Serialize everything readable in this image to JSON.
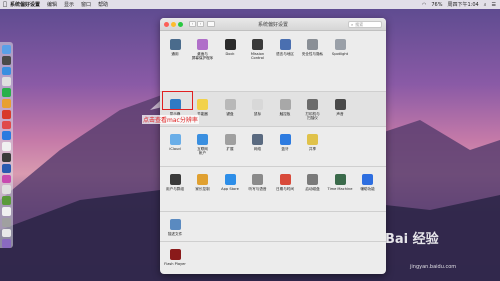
{
  "menubar": {
    "apple": "",
    "items": [
      "系统偏好设置",
      "编辑",
      "显示",
      "窗口",
      "帮助"
    ],
    "right": {
      "battery": "76%",
      "clock": "周四下午1:04"
    }
  },
  "window": {
    "title": "系统偏好设置",
    "search_placeholder": "搜索",
    "traffic_lights": [
      "#fc5f57",
      "#fdbc2e",
      "#28c840"
    ],
    "sections": [
      {
        "panes": [
          {
            "label": "通用",
            "icon": "general-icon",
            "color": "#4a6b8c"
          },
          {
            "label": "桌面与\n屏幕保护程序",
            "icon": "desktop-icon",
            "color": "#b06fc9"
          },
          {
            "label": "Dock",
            "icon": "dock-icon",
            "color": "#2b2b2b"
          },
          {
            "label": "Mission\nControl",
            "icon": "mission-control-icon",
            "color": "#3a3a3a"
          },
          {
            "label": "语言与地区",
            "icon": "language-icon",
            "color": "#4a6fb0"
          },
          {
            "label": "安全性与隐私",
            "icon": "security-icon",
            "color": "#8a8f96"
          },
          {
            "label": "Spotlight",
            "icon": "spotlight-icon",
            "color": "#9aa0a8"
          }
        ]
      },
      {
        "panes": [
          {
            "label": "显示器",
            "icon": "display-icon",
            "color": "#2f7bc4"
          },
          {
            "label": "节能器",
            "icon": "energy-saver-icon",
            "color": "#f2d24a"
          },
          {
            "label": "键盘",
            "icon": "keyboard-icon",
            "color": "#b8b8b8"
          },
          {
            "label": "鼠标",
            "icon": "mouse-icon",
            "color": "#d8d8d8"
          },
          {
            "label": "触控板",
            "icon": "trackpad-icon",
            "color": "#a8a8a8"
          },
          {
            "label": "打印机与\n扫描仪",
            "icon": "printer-icon",
            "color": "#6b6b6b"
          },
          {
            "label": "声音",
            "icon": "sound-icon",
            "color": "#4a4a4a"
          }
        ]
      },
      {
        "panes": [
          {
            "label": "iCloud",
            "icon": "icloud-icon",
            "color": "#6aaee8"
          },
          {
            "label": "互联网\n帐户",
            "icon": "internet-accounts-icon",
            "color": "#3a8fe0"
          },
          {
            "label": "扩展",
            "icon": "extensions-icon",
            "color": "#a0a0a0"
          },
          {
            "label": "网络",
            "icon": "network-icon",
            "color": "#5a6a80"
          },
          {
            "label": "蓝牙",
            "icon": "bluetooth-icon",
            "color": "#2d7be0"
          },
          {
            "label": "共享",
            "icon": "sharing-icon",
            "color": "#e0c24a"
          }
        ]
      },
      {
        "panes": [
          {
            "label": "用户与群组",
            "icon": "users-icon",
            "color": "#3a3a3a"
          },
          {
            "label": "家长控制",
            "icon": "parental-controls-icon",
            "color": "#e0a030"
          },
          {
            "label": "App Store",
            "icon": "app-store-icon",
            "color": "#2d8ee8"
          },
          {
            "label": "听写与语音",
            "icon": "dictation-icon",
            "color": "#8a8a8a"
          },
          {
            "label": "日期与时间",
            "icon": "date-time-icon",
            "color": "#d84a3a"
          },
          {
            "label": "启动磁盘",
            "icon": "startup-disk-icon",
            "color": "#7a7a7a"
          },
          {
            "label": "Time Machine",
            "icon": "time-machine-icon",
            "color": "#3a6a4a"
          },
          {
            "label": "辅助功能",
            "icon": "accessibility-icon",
            "color": "#2d6ee0"
          }
        ]
      },
      {
        "panes": [
          {
            "label": "描述文件",
            "icon": "profiles-icon",
            "color": "#5a8ac0"
          }
        ]
      },
      {
        "panes": [
          {
            "label": "Flash Player",
            "icon": "flash-player-icon",
            "color": "#8a1a1a"
          }
        ]
      }
    ]
  },
  "annotation": {
    "text": "点击查看mac分辨率"
  },
  "watermark": {
    "text": "Bai 经验",
    "sub": "jingyan.baidu.com"
  },
  "dock_colors": [
    "#5aa0e8",
    "#4a4a4a",
    "#3a8fe0",
    "#e0e0e0",
    "#2ab04a",
    "#e8a030",
    "#d83a2a",
    "#e04a4a",
    "#2a7ae0",
    "#f0f0f0",
    "#3a3a3a",
    "#2a5ab0",
    "#c84ab0",
    "#e0e0e0",
    "#5a9a3a",
    "#f0f0f0",
    "#a0a0a0",
    "#e8e8e8",
    "#8a6ac0"
  ]
}
